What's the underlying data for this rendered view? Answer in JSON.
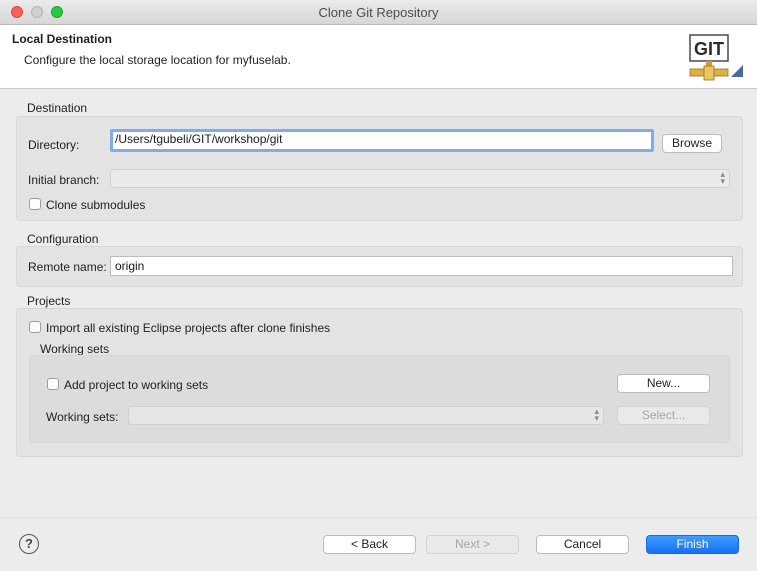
{
  "window": {
    "title": "Clone Git Repository"
  },
  "header": {
    "title": "Local Destination",
    "description": "Configure the local storage location for myfuselab.",
    "logo_text": "GIT"
  },
  "destination": {
    "group_label": "Destination",
    "directory_label": "Directory:",
    "directory_value": "/Users/tgubeli/GIT/workshop/git",
    "browse_label": "Browse",
    "initial_branch_label": "Initial branch:",
    "initial_branch_value": "",
    "clone_submodules_label": "Clone submodules",
    "clone_submodules_checked": false
  },
  "configuration": {
    "group_label": "Configuration",
    "remote_name_label": "Remote name:",
    "remote_name_value": "origin"
  },
  "projects": {
    "group_label": "Projects",
    "import_label": "Import all existing Eclipse projects after clone finishes",
    "import_checked": false,
    "working_sets": {
      "group_label": "Working sets",
      "add_label": "Add project to working sets",
      "add_checked": false,
      "new_label": "New...",
      "working_sets_label": "Working sets:",
      "working_sets_value": "",
      "select_label": "Select..."
    }
  },
  "footer": {
    "help_glyph": "?",
    "back_label": "< Back",
    "next_label": "Next >",
    "cancel_label": "Cancel",
    "finish_label": "Finish"
  },
  "colors": {
    "accent": "#1670f2",
    "focus_ring": "#7eaee8",
    "close": "#fd5f57",
    "maximize": "#28c840"
  }
}
